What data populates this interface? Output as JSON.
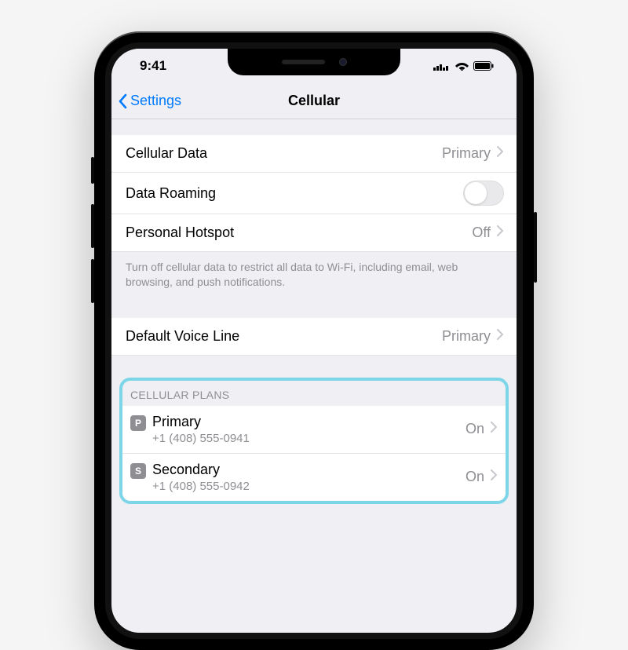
{
  "status": {
    "time": "9:41"
  },
  "nav": {
    "back_label": "Settings",
    "title": "Cellular"
  },
  "rows": {
    "cellular_data_label": "Cellular Data",
    "cellular_data_value": "Primary",
    "data_roaming_label": "Data Roaming",
    "personal_hotspot_label": "Personal Hotspot",
    "personal_hotspot_value": "Off",
    "footer": "Turn off cellular data to restrict all data to Wi-Fi, including email, web browsing, and push notifications.",
    "default_voice_label": "Default Voice Line",
    "default_voice_value": "Primary"
  },
  "plans": {
    "header": "CELLULAR PLANS",
    "items": [
      {
        "badge": "P",
        "name": "Primary",
        "number": "+1 (408) 555-0941",
        "status": "On"
      },
      {
        "badge": "S",
        "name": "Secondary",
        "number": "+1 (408) 555-0942",
        "status": "On"
      }
    ]
  }
}
